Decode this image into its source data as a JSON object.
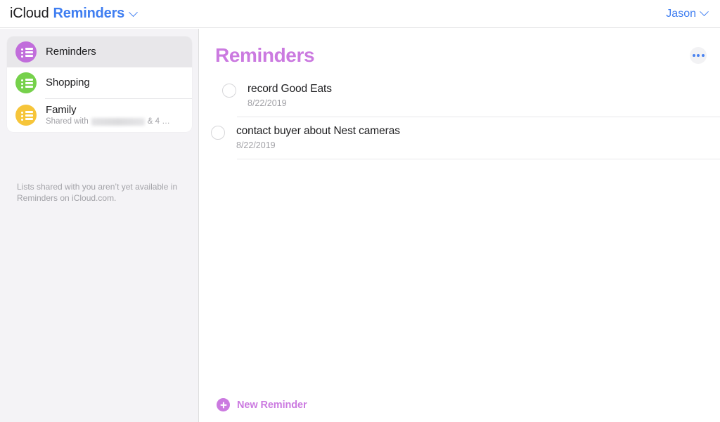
{
  "header": {
    "brand_prefix": "iCloud",
    "brand_app": "Reminders",
    "brand_chevron_icon": "chevron-down-icon",
    "account_name": "Jason",
    "account_chevron_icon": "chevron-down-icon"
  },
  "sidebar": {
    "lists": [
      {
        "title": "Reminders",
        "subtitle": "",
        "color": "#c16ddb",
        "icon": "list-circle-icon",
        "selected": true,
        "redacted": false
      },
      {
        "title": "Shopping",
        "subtitle": "",
        "color": "#76d14b",
        "icon": "list-circle-icon",
        "selected": false,
        "redacted": false
      },
      {
        "title": "Family",
        "subtitle_prefix": "Shared with",
        "subtitle_suffix": "& 4 …",
        "color": "#f6c53a",
        "icon": "list-circle-icon",
        "selected": false,
        "redacted": true
      }
    ],
    "note": "Lists shared with you aren’t yet available in Reminders on iCloud.com."
  },
  "main": {
    "title": "Reminders",
    "title_color": "#cb7ae0",
    "more_button_icon": "ellipsis-icon",
    "reminders": [
      {
        "title": "record Good Eats",
        "date": "8/22/2019",
        "completed": false
      },
      {
        "title": "contact buyer about Nest cameras",
        "date": "8/22/2019",
        "completed": false
      }
    ],
    "new_reminder": {
      "label": "New Reminder",
      "icon": "plus-circle-icon"
    }
  },
  "colors": {
    "accent_purple": "#cb7ae0",
    "link_blue": "#3f7ef1",
    "sidebar_bg": "#f4f3f6"
  }
}
